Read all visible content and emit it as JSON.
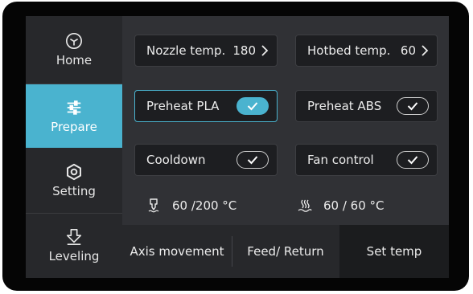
{
  "sidebar": {
    "items": [
      {
        "label": "Home",
        "icon": "cube-icon",
        "active": false
      },
      {
        "label": "Prepare",
        "icon": "sliders-icon",
        "active": true
      },
      {
        "label": "Setting",
        "icon": "hex-nut-icon",
        "active": false
      },
      {
        "label": "Leveling",
        "icon": "leveling-arrow-icon",
        "active": false
      }
    ]
  },
  "cards": {
    "nozzle": {
      "label": "Nozzle temp.",
      "value": "180"
    },
    "hotbed": {
      "label": "Hotbed temp.",
      "value": "60"
    },
    "preheat_pla": {
      "label": "Preheat PLA",
      "checked": true
    },
    "preheat_abs": {
      "label": "Preheat ABS",
      "checked": false
    },
    "cooldown": {
      "label": "Cooldown"
    },
    "fan_control": {
      "label": "Fan control"
    }
  },
  "status": {
    "nozzle_temp": "60 /200 °C",
    "bed_temp": "60 / 60 °C"
  },
  "bottom_tabs": [
    {
      "label": "Axis movement",
      "active": false
    },
    {
      "label": "Feed/ Return",
      "active": false
    },
    {
      "label": "Set temp",
      "active": true
    }
  ],
  "colors": {
    "accent": "#4ab3cf",
    "card": "#1d1e21",
    "panel": "#303135"
  }
}
